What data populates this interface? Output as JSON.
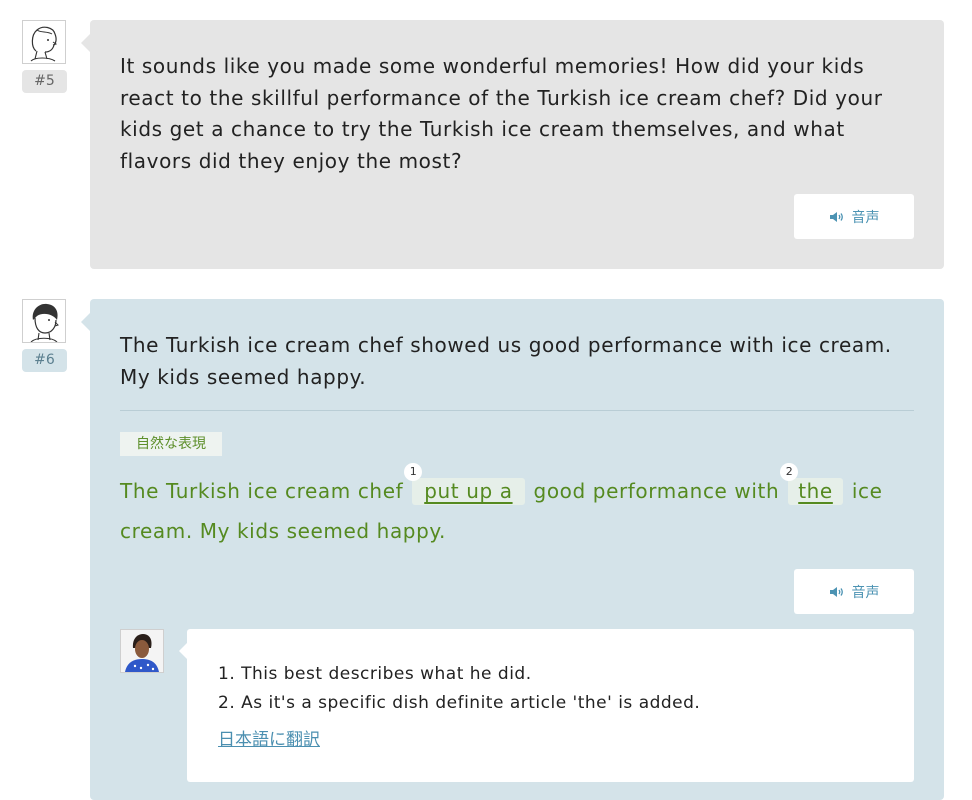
{
  "messages": [
    {
      "number": "#5",
      "text": "It sounds like you made some wonderful memories! How did your kids react to the skillful performance of the Turkish ice cream chef? Did your kids get a chance to try the Turkish ice cream themselves, and what flavors did they enjoy the most?",
      "audio_label": "音声",
      "avatar_icon": "sketch-person-avatar-icon"
    },
    {
      "number": "#6",
      "text": "The Turkish ice cream chef showed us good performance with ice cream. My kids seemed happy.",
      "audio_label": "音声",
      "avatar_icon": "sketch-person-avatar-icon",
      "correction": {
        "tag": "自然な表現",
        "part1": "The Turkish ice cream chef",
        "mark1_num": "1",
        "mark1_text": "put up a",
        "part2": "good performance with",
        "mark2_num": "2",
        "mark2_text": "the",
        "part3": "ice cream. My kids seemed happy."
      },
      "tutor_comment": {
        "items": [
          "1. This best describes what he did.",
          "2. As it's a specific dish definite article 'the' is added."
        ],
        "translate_link": "日本語に翻訳",
        "avatar_icon": "tutor-photo-avatar-icon"
      }
    }
  ],
  "colors": {
    "gray_bubble": "#e5e5e5",
    "blue_bubble": "#d4e3e9",
    "correction_green": "#558a20",
    "link_blue": "#4b8fb0"
  }
}
